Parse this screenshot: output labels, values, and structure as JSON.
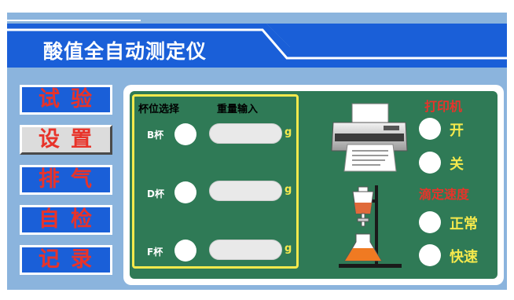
{
  "title": "酸值全自动测定仪",
  "nav": [
    {
      "label": "试验",
      "active": false
    },
    {
      "label": "设置",
      "active": true
    },
    {
      "label": "排气",
      "active": false
    },
    {
      "label": "自检",
      "active": false
    },
    {
      "label": "记录",
      "active": false
    }
  ],
  "cup_select": {
    "header_cup": "杯位选择",
    "header_weight": "重量输入",
    "cups": [
      {
        "label": "B杯",
        "unit": "g"
      },
      {
        "label": "D杯",
        "unit": "g"
      },
      {
        "label": "F杯",
        "unit": "g"
      }
    ]
  },
  "printer": {
    "title": "打印机",
    "on_label": "开",
    "off_label": "关",
    "icon": "printer-icon"
  },
  "titration_speed": {
    "title": "滴定速度",
    "normal_label": "正常",
    "fast_label": "快速",
    "icon": "titration-apparatus-icon"
  },
  "colors": {
    "title_bar": "#1a5fd8",
    "frame": "#8bb4dd",
    "panel_green": "#2f7a56",
    "highlight_yellow": "#f5e94c",
    "red_text": "#e8332a"
  }
}
